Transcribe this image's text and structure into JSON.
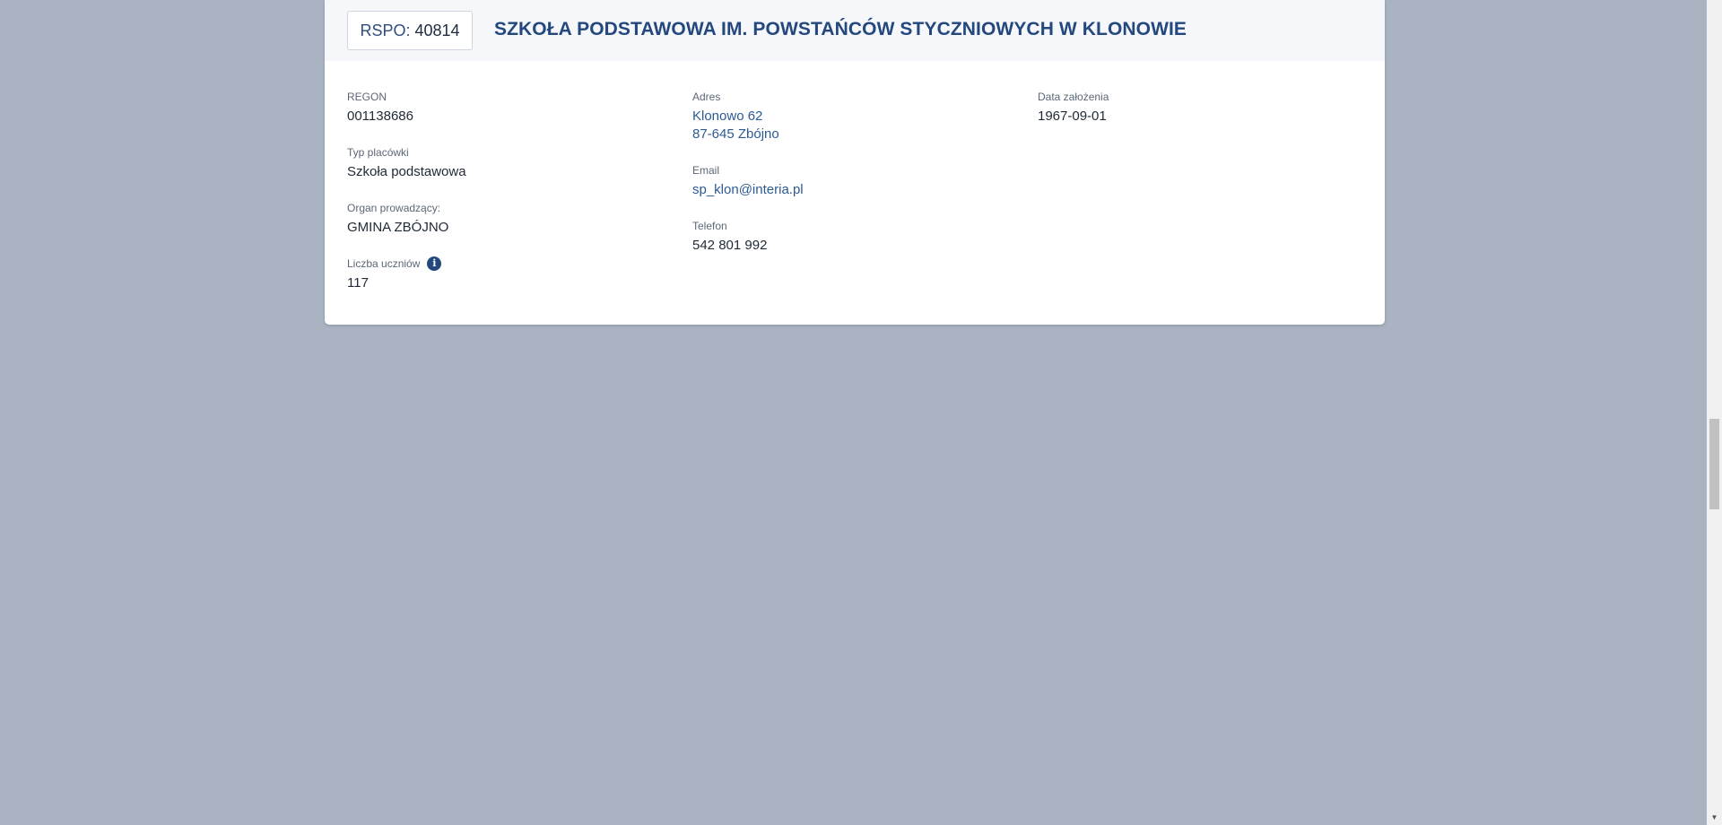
{
  "header": {
    "rspo_label": "RSPO:",
    "rspo_value": "40814",
    "school_name": "SZKOŁA PODSTAWOWA IM. POWSTAŃCÓW STYCZNIOWYCH W KLONOWIE"
  },
  "details": {
    "regon": {
      "label": "REGON",
      "value": "001138686"
    },
    "type": {
      "label": "Typ placówki",
      "value": "Szkoła podstawowa"
    },
    "organ": {
      "label": "Organ prowadzący:",
      "value": "GMINA ZBÓJNO"
    },
    "students": {
      "label": "Liczba uczniów",
      "value": "117"
    },
    "address": {
      "label": "Adres",
      "line1": "Klonowo 62",
      "line2": "87-645 Zbójno"
    },
    "email": {
      "label": "Email",
      "value": "sp_klon@interia.pl"
    },
    "phone": {
      "label": "Telefon",
      "value": "542 801 992"
    },
    "founded": {
      "label": "Data założenia",
      "value": "1967-09-01"
    }
  },
  "icons": {
    "info": "info-icon",
    "scroll_down": "chevron-down-icon"
  },
  "colors": {
    "page_background": "#a9b3c1",
    "accent": "#24487e",
    "link": "#2d5a93"
  }
}
